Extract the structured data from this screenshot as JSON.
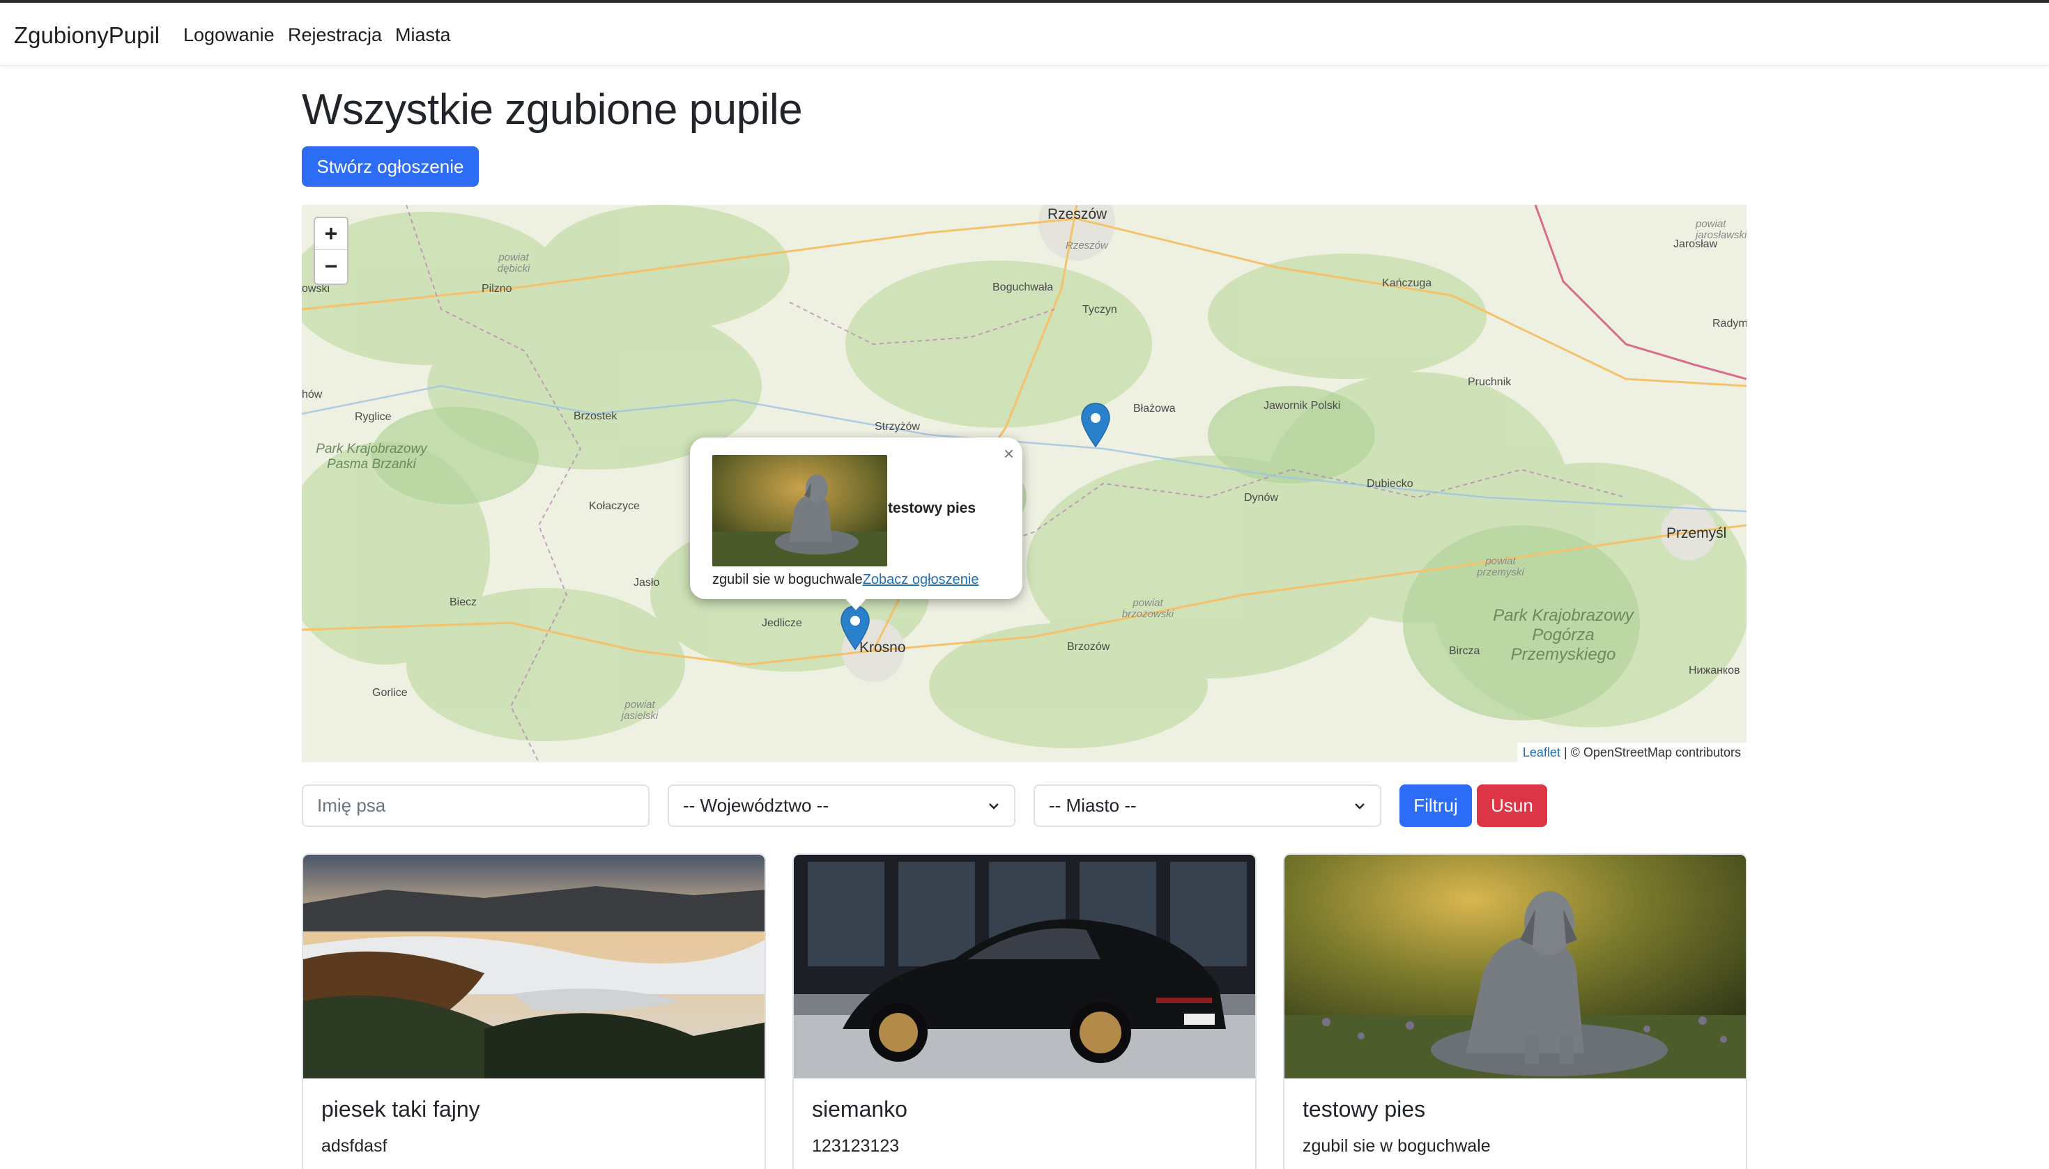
{
  "navbar": {
    "brand": "ZgubionyPupil",
    "links": [
      "Logowanie",
      "Rejestracja",
      "Miasta"
    ]
  },
  "page": {
    "title": "Wszystkie zgubione pupile",
    "create_button": "Stwórz ogłoszenie"
  },
  "map": {
    "zoom_in": "+",
    "zoom_out": "−",
    "places": [
      "Rzeszów",
      "Rzeszów",
      "Jarosław",
      "powiat jarosławski",
      "Pilzno",
      "powiat dębicki",
      "Boguchwała",
      "Tyczyn",
      "Kańczuga",
      "Radym",
      "Ryglice",
      "Brzostek",
      "Strzyżów",
      "Błażowa",
      "Jawornik Polski",
      "Pruchnik",
      "Park Krajobrazowy Pasma Brzanki",
      "Kołaczyce",
      "Dynów",
      "Dubiecko",
      "Przemyśl",
      "powiat przemyski",
      "Jasło",
      "Biecz",
      "Jedlicze",
      "Krosno",
      "powiat brzozowski",
      "Brzozów",
      "Park Krajobrazowy Pogórza Przemyskiego",
      "Bircza",
      "Gorlice",
      "powiat jasielski",
      "Нижанков",
      "hów",
      "owski"
    ],
    "popup": {
      "close": "×",
      "name": "testowy pies",
      "description": "zgubil sie w boguchwale",
      "link": "Zobacz ogłoszenie"
    },
    "attribution_leaflet": "Leaflet",
    "attribution_rest": " | © OpenStreetMap contributors"
  },
  "filters": {
    "name_placeholder": "Imię psa",
    "voivodeship": "-- Województwo --",
    "city": "-- Miasto --",
    "filter_button": "Filtruj",
    "clear_button": "Usun"
  },
  "cards": [
    {
      "title": "piesek taki fajny",
      "text": "adsfdasf"
    },
    {
      "title": "siemanko",
      "text": "123123123"
    },
    {
      "title": "testowy pies",
      "text": "zgubil sie w boguchwale"
    }
  ],
  "colors": {
    "primary": "#2d6cf5",
    "danger": "#dc3545",
    "link": "#1f6fb5",
    "marker": "#2a81cb"
  }
}
